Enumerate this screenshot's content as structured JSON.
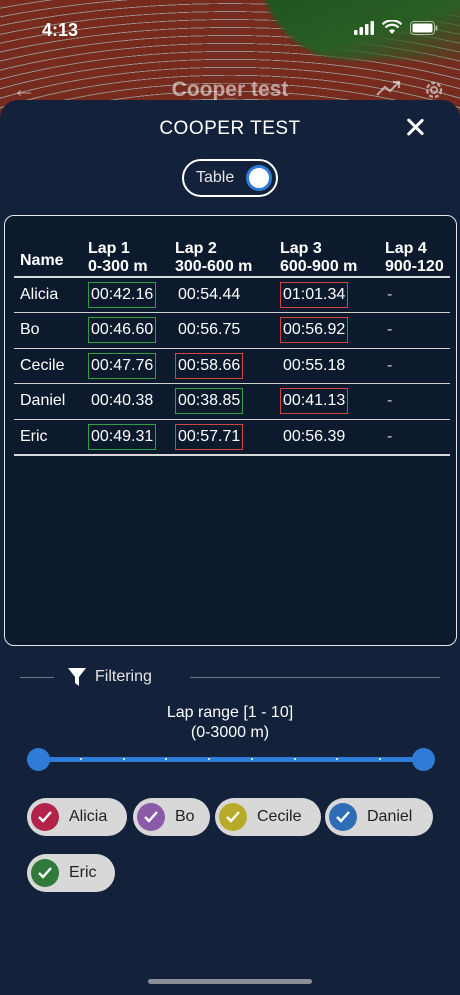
{
  "status_bar": {
    "time": "4:13"
  },
  "background_appbar": {
    "title": "Cooper test"
  },
  "sheet": {
    "title": "COOPER TEST",
    "toggle_label": "Table"
  },
  "table": {
    "columns": [
      {
        "line1": "Name",
        "line2": ""
      },
      {
        "line1": "Lap 1",
        "line2": "0-300 m"
      },
      {
        "line1": "Lap 2",
        "line2": "300-600 m"
      },
      {
        "line1": "Lap 3",
        "line2": "600-900 m"
      },
      {
        "line1": "Lap 4",
        "line2": "900-120"
      }
    ],
    "rows": [
      {
        "name": "Alicia",
        "lap1": "00:42.16",
        "lap2": "00:54.44",
        "lap3": "01:01.34",
        "lap4": "-"
      },
      {
        "name": "Bo",
        "lap1": "00:46.60",
        "lap2": "00:56.75",
        "lap3": "00:56.92",
        "lap4": "-"
      },
      {
        "name": "Cecile",
        "lap1": "00:47.76",
        "lap2": "00:58.66",
        "lap3": "00:55.18",
        "lap4": "-"
      },
      {
        "name": "Daniel",
        "lap1": "00:40.38",
        "lap2": "00:38.85",
        "lap3": "00:41.13",
        "lap4": "-"
      },
      {
        "name": "Eric",
        "lap1": "00:49.31",
        "lap2": "00:57.71",
        "lap3": "00:56.39",
        "lap4": "-"
      }
    ],
    "highlight_colors": {
      "best": "#2fa043",
      "worst": "#d0463d"
    }
  },
  "filtering": {
    "label": "Filtering",
    "lap_range": "Lap range [1 - 10]",
    "distance_range": "(0-3000 m)",
    "slider": {
      "min": 1,
      "max": 10,
      "value_low": 1,
      "value_high": 10
    }
  },
  "runners": [
    {
      "name": "Alicia",
      "color": "#b2234a",
      "checked": true
    },
    {
      "name": "Bo",
      "color": "#8b5aa8",
      "checked": true
    },
    {
      "name": "Cecile",
      "color": "#b8ab2a",
      "checked": true
    },
    {
      "name": "Daniel",
      "color": "#2e6db5",
      "checked": true
    },
    {
      "name": "Eric",
      "color": "#2f7a3b",
      "checked": true
    }
  ],
  "accent_color": "#2e7cd6"
}
